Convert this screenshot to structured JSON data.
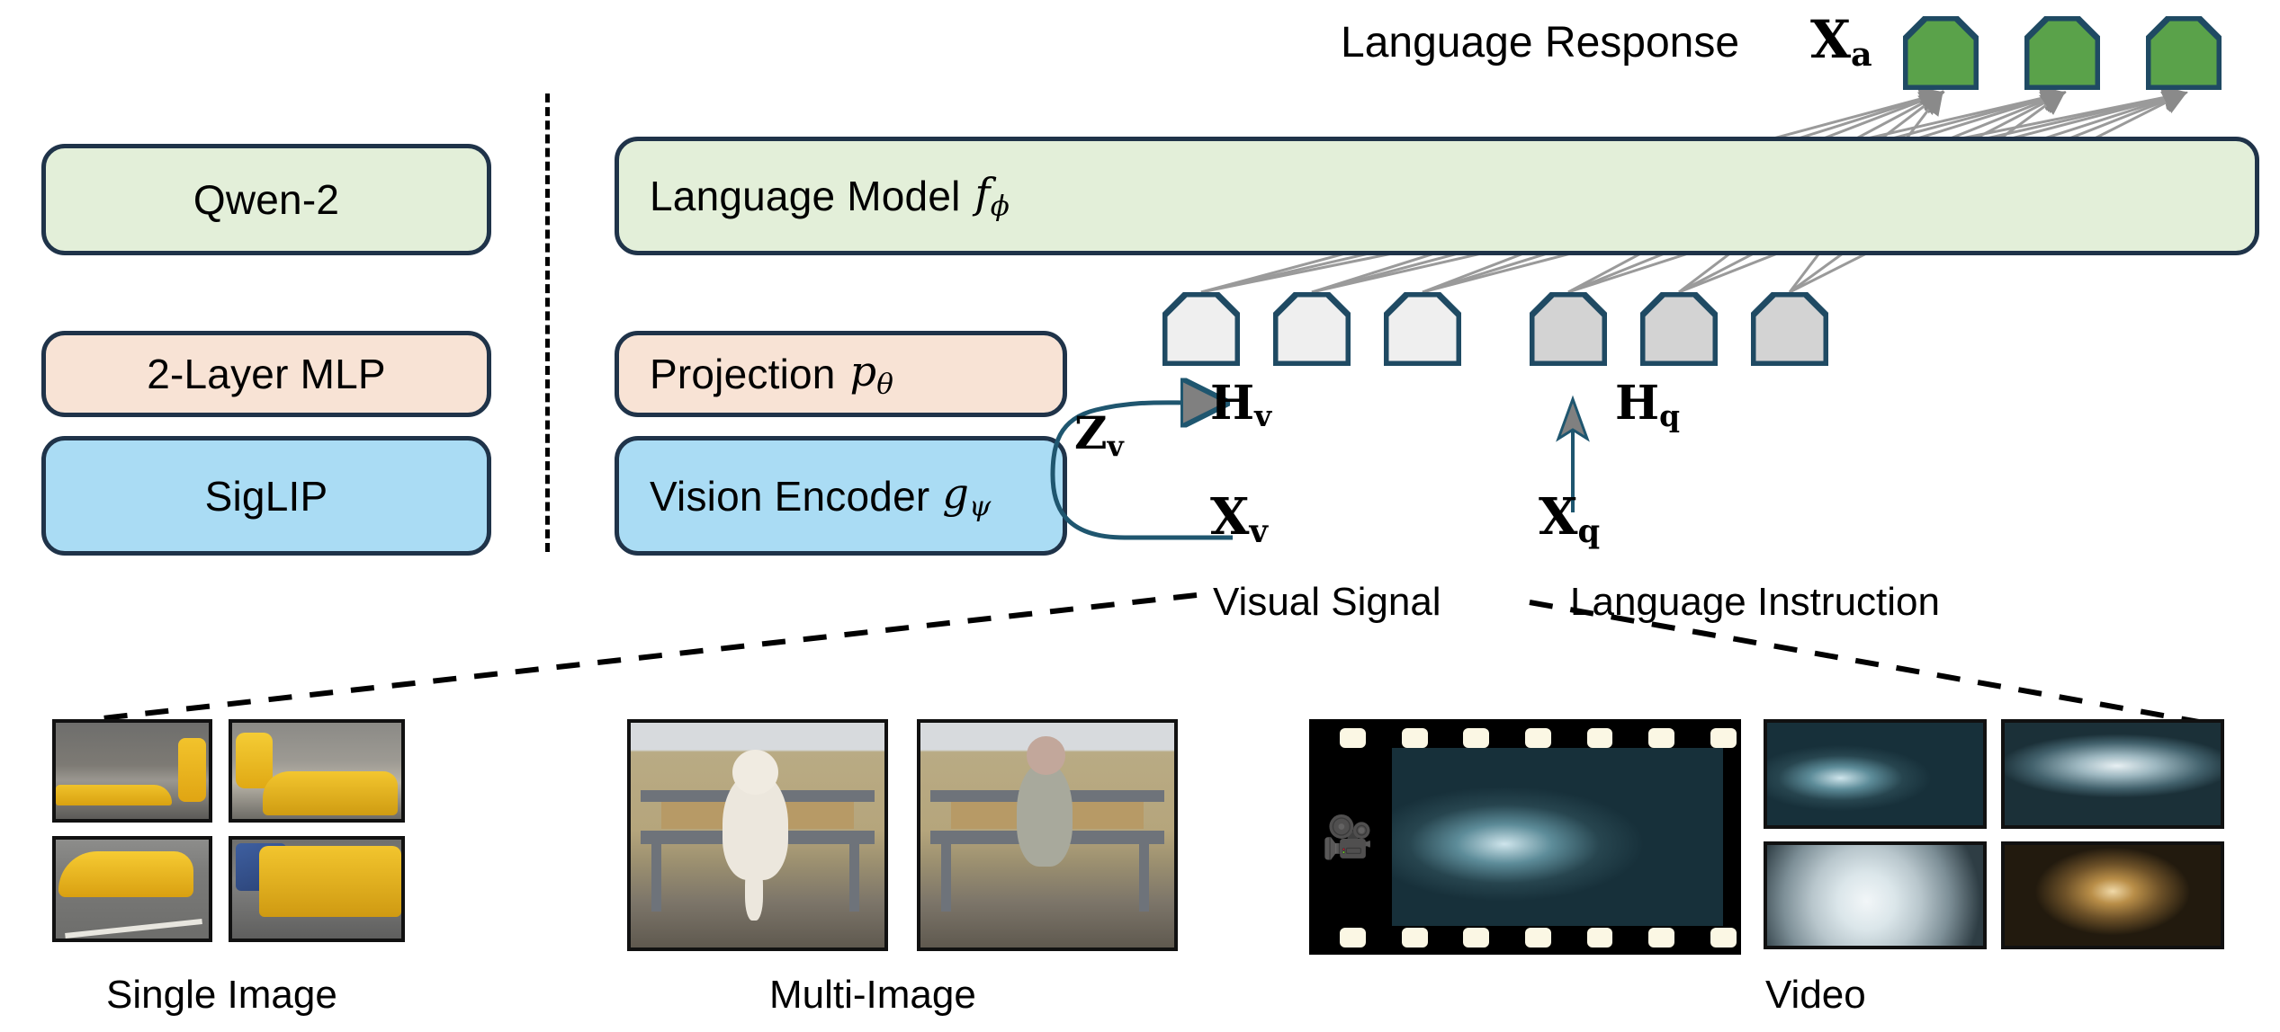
{
  "figure": {
    "title_implicit": "Multimodal model architecture overview"
  },
  "left_column": {
    "items": [
      {
        "label": "Qwen-2",
        "color": "#e3efd9",
        "role": "language-model-backbone"
      },
      {
        "label": "2-Layer MLP",
        "color": "#f8e3d5",
        "role": "projection-implementation"
      },
      {
        "label": "SigLIP",
        "color": "#aadcf4",
        "role": "vision-encoder-implementation"
      }
    ]
  },
  "right_column": {
    "language_model": {
      "label": "Language Model",
      "symbol": "f",
      "subscript": "ϕ",
      "color": "#e3efd9"
    },
    "projection": {
      "label": "Projection",
      "symbol": "p",
      "subscript": "θ",
      "color": "#f8e3d5"
    },
    "vision_encoder": {
      "label": "Vision Encoder",
      "symbol": "g",
      "subscript": "ψ",
      "color": "#aadcf4"
    }
  },
  "annotations": {
    "language_response": "Language Response",
    "x_a": {
      "base": "X",
      "sub": "a"
    },
    "z_v": {
      "base": "Z",
      "sub": "v"
    },
    "h_v": {
      "base": "H",
      "sub": "v"
    },
    "h_q": {
      "base": "H",
      "sub": "q"
    },
    "x_v": {
      "base": "X",
      "sub": "v"
    },
    "x_q": {
      "base": "X",
      "sub": "q"
    },
    "visual_signal": "Visual Signal",
    "language_instruction": "Language Instruction"
  },
  "tokens": {
    "visual": {
      "count": 3,
      "fill": "#efefef",
      "stroke": "#1f4a63"
    },
    "query": {
      "count": 3,
      "fill": "#d3d3d3",
      "stroke": "#1f4a63"
    },
    "answer": {
      "count": 3,
      "fill": "#5aa24a",
      "stroke": "#1f4a63"
    }
  },
  "inputs": [
    {
      "caption": "Single Image",
      "kind": "single-image",
      "thumbnails": [
        "street-scene-storefront-taxi",
        "man-ironing-on-taxi-roof",
        "yellow-taxi-driving-on-road",
        "man-on-rear-of-yellow-suv"
      ]
    },
    {
      "caption": "Multi-Image",
      "kind": "multi-image",
      "thumbnails": [
        "white-dog-sitting-on-bench",
        "monkey-with-controller-on-bench"
      ]
    },
    {
      "caption": "Video",
      "kind": "video",
      "film_strip": "wave-inside-ornate-hall",
      "perforations_per_row": 7,
      "thumbnails": [
        "wave-barrel-in-hall",
        "surfer-riding-wave-in-hall",
        "motion-blurred-whitewater",
        "empty-ornate-hall"
      ]
    }
  ],
  "colors": {
    "box_border": "#1f3349",
    "green_fill": "#e3efd9",
    "peach_fill": "#f8e3d5",
    "blue_fill": "#aadcf4",
    "token_stroke": "#1f4a63",
    "arrow_gray": "#808080",
    "curve_navy": "#1f566f"
  }
}
